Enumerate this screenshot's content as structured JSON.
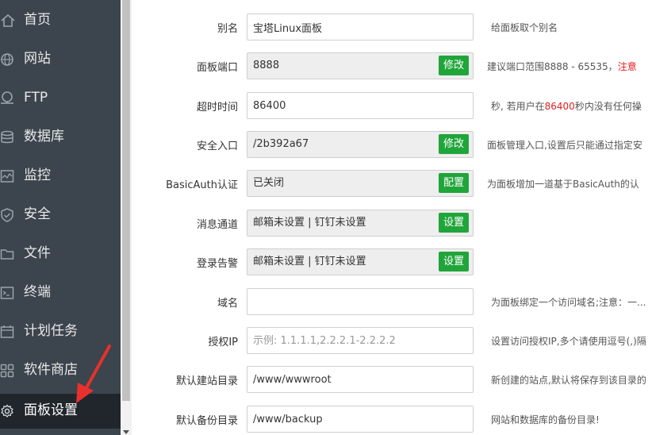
{
  "sidebar": {
    "items": [
      {
        "label": "首页",
        "icon": "home-icon"
      },
      {
        "label": "网站",
        "icon": "globe-icon"
      },
      {
        "label": "FTP",
        "icon": "ftp-icon"
      },
      {
        "label": "数据库",
        "icon": "database-icon"
      },
      {
        "label": "监控",
        "icon": "monitor-icon"
      },
      {
        "label": "安全",
        "icon": "shield-icon"
      },
      {
        "label": "文件",
        "icon": "folder-icon"
      },
      {
        "label": "终端",
        "icon": "terminal-icon"
      },
      {
        "label": "计划任务",
        "icon": "calendar-icon"
      },
      {
        "label": "软件商店",
        "icon": "apps-icon"
      },
      {
        "label": "面板设置",
        "icon": "gear-icon",
        "active": true
      }
    ]
  },
  "form": {
    "alias": {
      "label": "别名",
      "value": "宝塔Linux面板",
      "help": "给面板取个别名"
    },
    "port": {
      "label": "面板端口",
      "value": "8888",
      "button": "修改",
      "help_prefix": "建议端口范围8888 - 65535，",
      "help_red": "注意"
    },
    "timeout": {
      "label": "超时时间",
      "value": "86400",
      "help_prefix": "秒, 若用户在",
      "help_red": "86400",
      "help_suffix": "秒内没有任何操"
    },
    "entry": {
      "label": "安全入口",
      "value": "/2b392a67",
      "button": "修改",
      "help": "面板管理入口,设置后只能通过指定安"
    },
    "basicauth": {
      "label": "BasicAuth认证",
      "value": "已关闭",
      "button": "配置",
      "help": "为面板增加一道基于BasicAuth的认"
    },
    "message": {
      "label": "消息通道",
      "value": "邮箱未设置 | 钉钉未设置",
      "button": "设置"
    },
    "login_alert": {
      "label": "登录告警",
      "value": "邮箱未设置 | 钉钉未设置",
      "button": "设置"
    },
    "domain": {
      "label": "域名",
      "value": "",
      "help": "为面板绑定一个访问域名;注意：一..."
    },
    "auth_ip": {
      "label": "授权IP",
      "value": "",
      "placeholder": "示例: 1.1.1.1,2.2.2.1-2.2.2.2",
      "help": "设置访问授权IP,多个请使用逗号(,)隔"
    },
    "site_dir": {
      "label": "默认建站目录",
      "value": "/www/wwwroot",
      "help": "新创建的站点,默认将保存到该目录的"
    },
    "backup_dir": {
      "label": "默认备份目录",
      "value": "/www/backup",
      "help": "网站和数据库的备份目录!"
    }
  },
  "colors": {
    "sidebar_bg": "#3c444d",
    "sidebar_active_bg": "#20262c",
    "button_green": "#20a53a",
    "warning_red": "#e02020",
    "annotation_red": "#e8302c"
  }
}
